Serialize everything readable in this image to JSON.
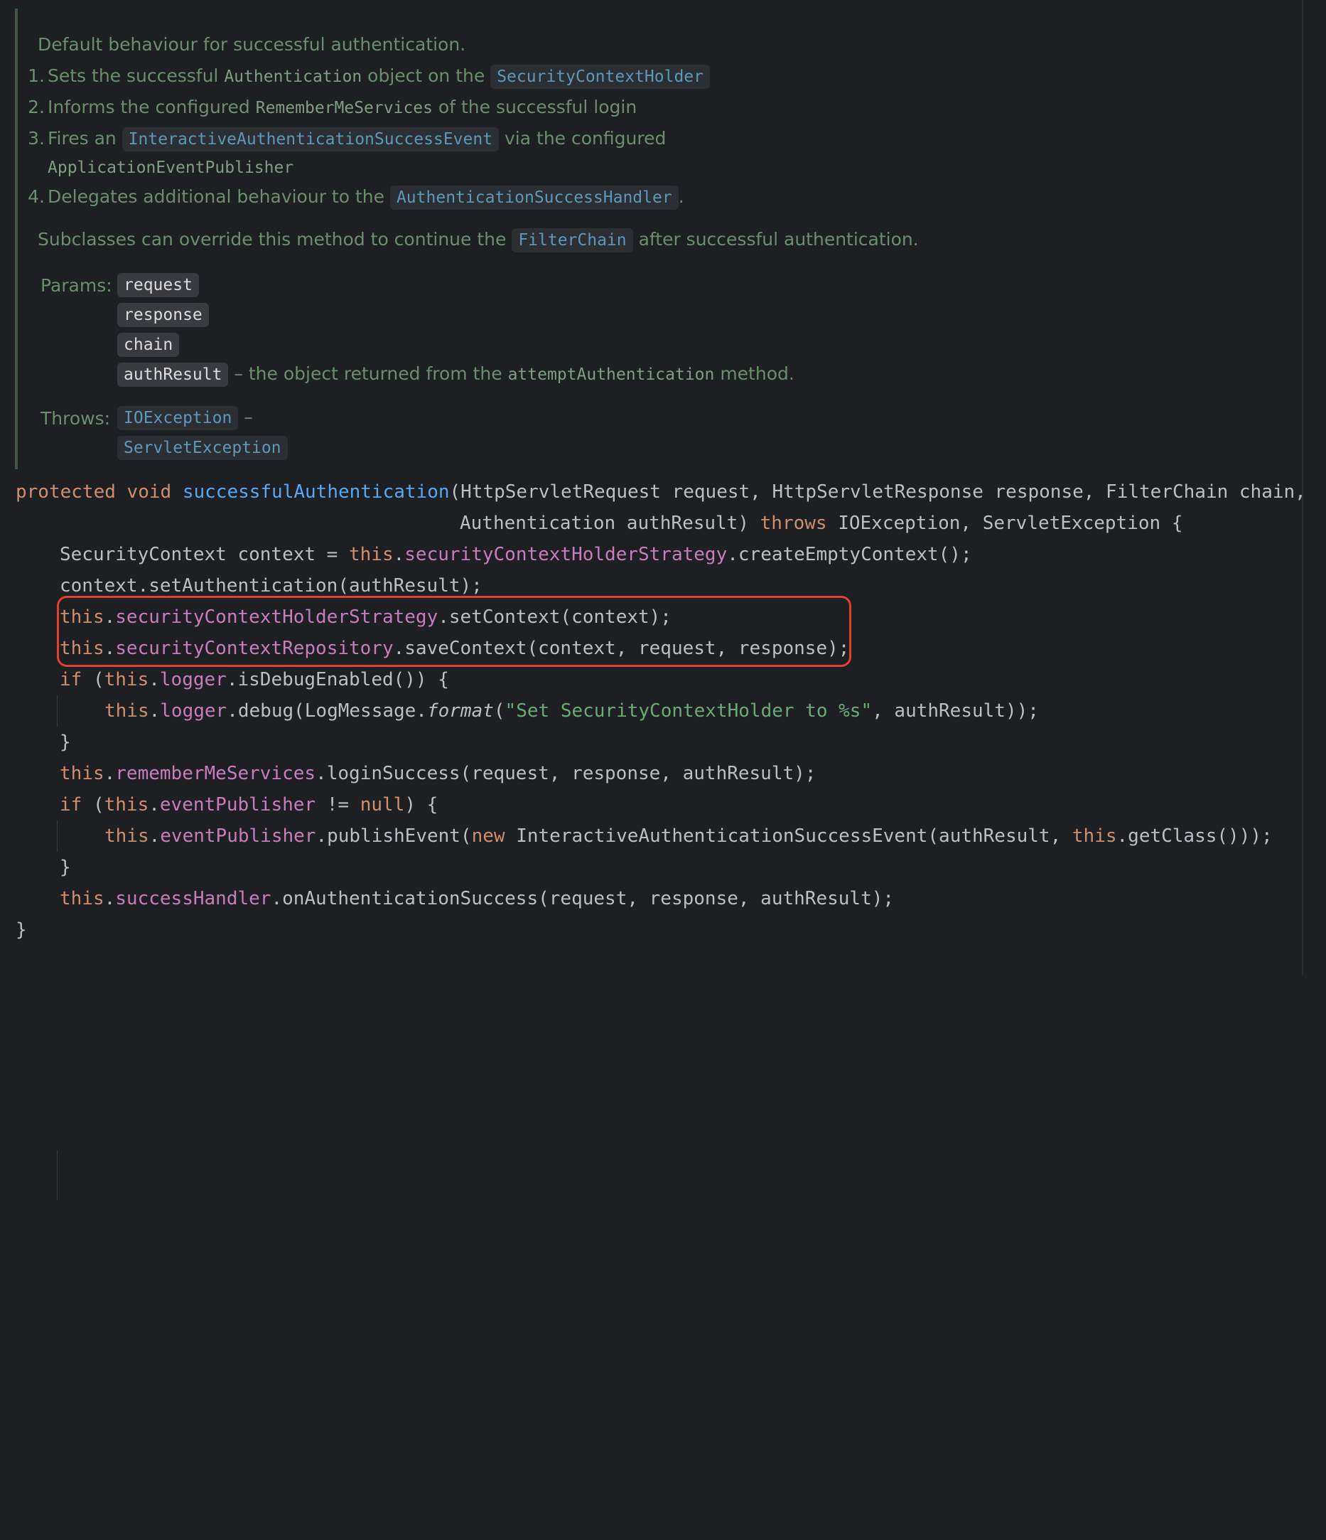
{
  "doc": {
    "intro": "Default behaviour for successful authentication.",
    "items": [
      {
        "num": "1.",
        "a": "Sets the successful ",
        "code": "Authentication",
        "b": " object on the ",
        "link": "SecurityContextHolder"
      },
      {
        "num": "2.",
        "a": "Informs the configured ",
        "code": "RememberMeServices",
        "b": " of the successful login"
      },
      {
        "num": "3.",
        "a": "Fires an ",
        "link": "InteractiveAuthenticationSuccessEvent",
        "b": " via the configured",
        "code2": "ApplicationEventPublisher"
      },
      {
        "num": "4.",
        "a": "Delegates additional behaviour to the ",
        "link": "AuthenticationSuccessHandler",
        "b": "."
      }
    ],
    "subclasses": {
      "a": "Subclasses can override this method to continue the ",
      "link": "FilterChain",
      "b": " after successful authentication."
    },
    "params_label": "Params:",
    "params": [
      "request",
      "response",
      "chain",
      "authResult"
    ],
    "param_note": {
      "dash": " – the object returned from the ",
      "code": "attemptAuthentication",
      "tail": " method."
    },
    "throws_label": "Throws:",
    "throws": [
      "IOException",
      "ServletException"
    ],
    "throws_dash": " –"
  },
  "code": {
    "kw_protected": "protected",
    "kw_void": "void",
    "method": "successfulAuthentication",
    "sig1": "(HttpServletRequest request, HttpServletResponse response, FilterChain chain,",
    "sig2": "Authentication authResult) ",
    "kw_throws": "throws",
    "sig3": " IOException, ServletException {",
    "this": "this",
    "l3a": "SecurityContext context = ",
    "f_strategy": "securityContextHolderStrategy",
    "l3b": ".createEmptyContext();",
    "l4": "context.setAuthentication(authResult);",
    "l5b": ".setContext(context);",
    "f_repo": "securityContextRepository",
    "l6b": ".saveContext(context, request, response);",
    "kw_if": "if",
    "f_logger": "logger",
    "l7b": ".isDebugEnabled()) {",
    "l8b": ".debug(LogMessage.",
    "l8fmt": "format",
    "l8str": "\"Set SecurityContextHolder to %s\"",
    "l8c": ", authResult));",
    "close": "}",
    "f_remember": "rememberMeServices",
    "l10b": ".loginSuccess(request, response, authResult);",
    "f_publisher": "eventPublisher",
    "l11b": " != ",
    "kw_null": "null",
    "l11c": ") {",
    "l12b": ".publishEvent(",
    "kw_new": "new",
    "l12c": " InteractiveAuthenticationSuccessEvent(authResult, ",
    "l12d": ".getClass()));",
    "f_success": "successHandler",
    "l14b": ".onAuthenticationSuccess(request, response, authResult);"
  },
  "colors": {
    "background": "#1e1f22",
    "keyword": "#cf8e6d",
    "method": "#56a8f5",
    "field": "#c77dbb",
    "string": "#6aab73",
    "doc_text": "#6a8e6e",
    "doc_link": "#5c98b8",
    "highlight": "#e0422c"
  }
}
